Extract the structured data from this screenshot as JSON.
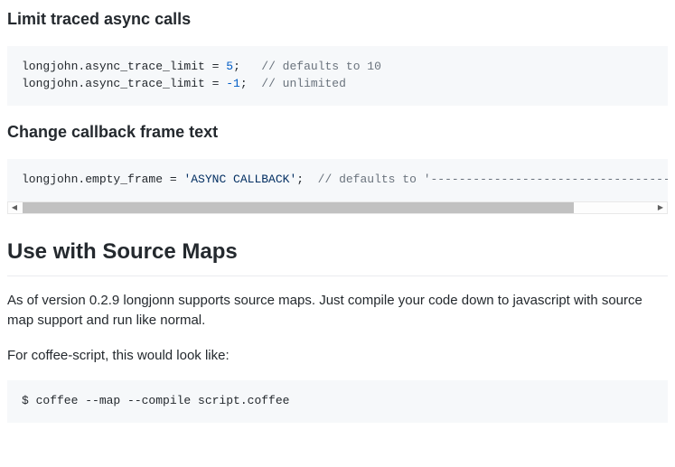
{
  "section1": {
    "heading": "Limit traced async calls",
    "code_line1_pre": "longjohn.async_trace_limit = ",
    "code_line1_val": "5",
    "code_line1_post": ";   ",
    "code_line1_comment": "// defaults to 10",
    "code_line2_pre": "longjohn.async_trace_limit = ",
    "code_line2_val": "-1",
    "code_line2_post": ";  ",
    "code_line2_comment": "// unlimited"
  },
  "section2": {
    "heading": "Change callback frame text",
    "code_pre": "longjohn.empty_frame = ",
    "code_str": "'ASYNC CALLBACK'",
    "code_post": ";  ",
    "code_comment": "// defaults to '---------------------------------------------'"
  },
  "section3": {
    "heading": "Use with Source Maps",
    "para1": "As of version 0.2.9 longjonn supports source maps. Just compile your code down to javascript with source map support and run like normal.",
    "para2": "For coffee-script, this would look like:",
    "code": "$ coffee --map --compile script.coffee"
  },
  "scrollbar": {
    "left": "◀",
    "right": "▶"
  }
}
